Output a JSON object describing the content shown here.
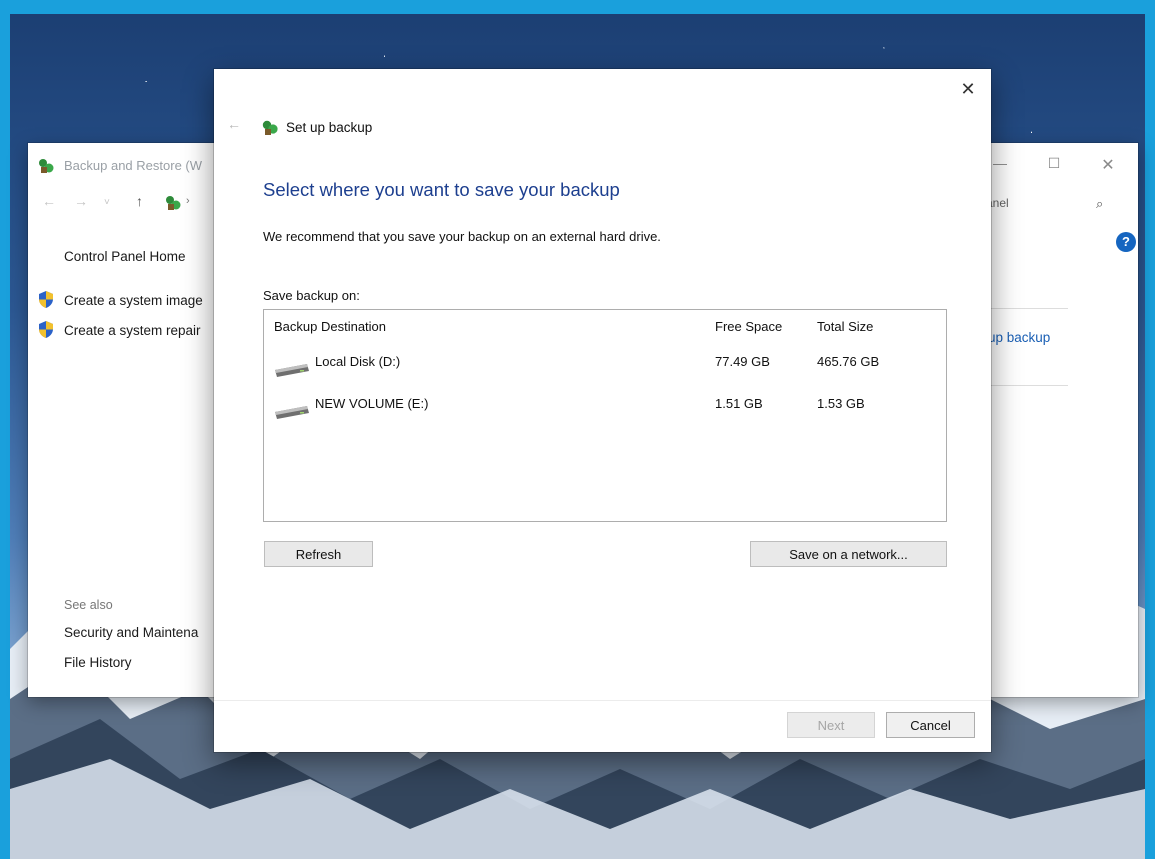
{
  "colors": {
    "screen_border": "#1aa0dc",
    "heading": "#1d3f8f",
    "link": "#1a5fb4",
    "help_badge": "#1565c0"
  },
  "icons": {
    "backup": "backup-restore-icon",
    "shield": "uac-shield-icon",
    "drive": "hard-drive-icon",
    "help": "help-icon",
    "search": "search-icon",
    "close": "close-icon"
  },
  "background_window": {
    "title": "Backup and Restore (W",
    "controls": {
      "minimize": "—",
      "maximize": "☐",
      "close": "✕"
    },
    "nav": {
      "back": "←",
      "forward": "→",
      "recent": "˅",
      "up": "↑",
      "separator": "›"
    },
    "search_text": "anel",
    "search_icon": "⌕",
    "help": "?",
    "sidebar": {
      "home": "Control Panel Home",
      "tasks": [
        {
          "label": "Create a system image"
        },
        {
          "label": "Create a system repair"
        }
      ],
      "see_also_label": "See also",
      "see_also": [
        {
          "label": "Security and Maintena"
        },
        {
          "label": "File History"
        }
      ]
    },
    "main_link": "up backup"
  },
  "dialog": {
    "close": "✕",
    "back": "←",
    "title": "Set up backup",
    "heading": "Select where you want to save your backup",
    "recommendation": "We recommend that you save your backup on an external hard drive.",
    "save_on_label": "Save backup on:",
    "table": {
      "columns": {
        "destination": "Backup Destination",
        "free": "Free Space",
        "total": "Total Size"
      },
      "rows": [
        {
          "name": "Local Disk (D:)",
          "free": "77.49 GB",
          "total": "465.76 GB"
        },
        {
          "name": "NEW VOLUME (E:)",
          "free": "1.51 GB",
          "total": "1.53 GB"
        }
      ]
    },
    "buttons": {
      "refresh": "Refresh",
      "network": "Save on a network...",
      "next": "Next",
      "cancel": "Cancel"
    }
  }
}
